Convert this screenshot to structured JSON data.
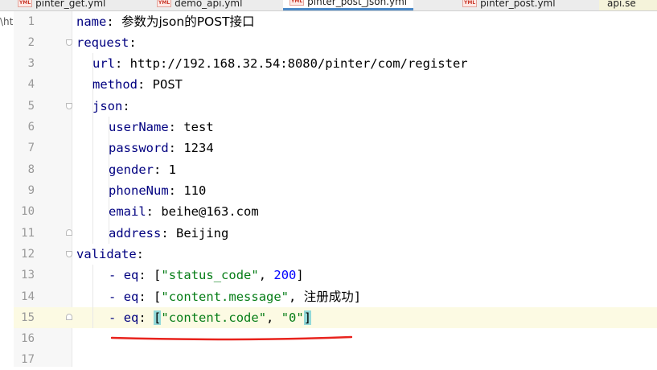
{
  "tabs": [
    {
      "icon": "YML",
      "label": "pinter_get.yml"
    },
    {
      "icon": "YML",
      "label": "demo_api.yml"
    },
    {
      "icon": "YML",
      "label": "pinter_post_json.yml"
    },
    {
      "icon": "YML",
      "label": "pinter_post.yml"
    },
    {
      "icon": "",
      "label": "api.se"
    }
  ],
  "left_fragment": "\\ht",
  "line_numbers": [
    "1",
    "2",
    "3",
    "4",
    "5",
    "6",
    "7",
    "8",
    "9",
    "10",
    "11",
    "12",
    "13",
    "14",
    "15",
    "16",
    "17"
  ],
  "code": {
    "l1": {
      "key": "name",
      "value": "参数为json的POST接口"
    },
    "l2": {
      "key": "request"
    },
    "l3": {
      "key": "url",
      "value": "http://192.168.32.54:8080/pinter/com/register"
    },
    "l4": {
      "key": "method",
      "value": "POST"
    },
    "l5": {
      "key": "json"
    },
    "l6": {
      "key": "userName",
      "value": "test"
    },
    "l7": {
      "key": "password",
      "value": "1234"
    },
    "l8": {
      "key": "gender",
      "value": "1"
    },
    "l9": {
      "key": "phoneNum",
      "value": "110"
    },
    "l10": {
      "key": "email",
      "value": "beihe@163.com"
    },
    "l11": {
      "key": "address",
      "value": "Beijing"
    },
    "l12": {
      "key": "validate"
    },
    "l13": {
      "dash": "-",
      "key": "eq",
      "s1": "\"status_code\"",
      "v2": "200"
    },
    "l14": {
      "dash": "-",
      "key": "eq",
      "s1": "\"content.message\"",
      "v2": "注册成功"
    },
    "l15": {
      "dash": "-",
      "key": "eq",
      "s1": "\"content.code\"",
      "s2": "\"0\""
    }
  },
  "colors": {
    "key": "#000080",
    "string": "#067d17",
    "number": "#0000ff",
    "current_line": "#fcfae3",
    "bracket_highlight": "#93d9d9",
    "annotation": "#e8231d"
  }
}
